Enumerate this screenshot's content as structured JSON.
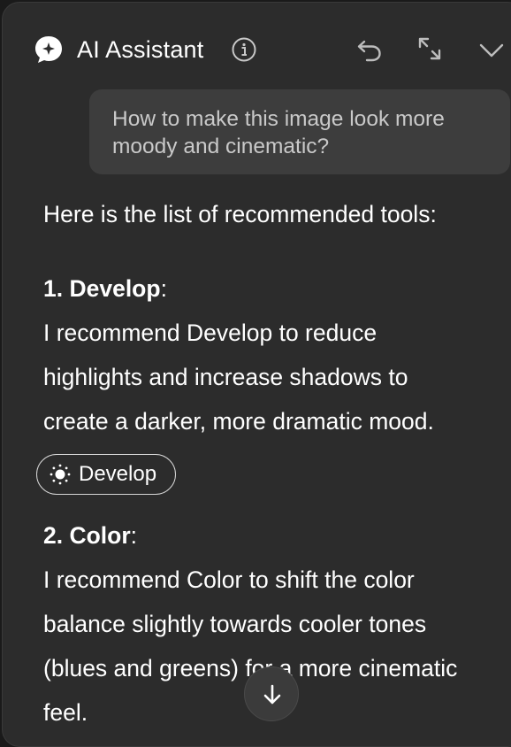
{
  "header": {
    "title": "AI Assistant",
    "icons": [
      "assistant-logo-icon",
      "info-icon",
      "undo-icon",
      "expand-icon",
      "chevron-down-icon"
    ]
  },
  "user_message": {
    "text": "How to make this image look more moody and cinematic?"
  },
  "assistant": {
    "intro": "Here is the list of recommended tools:",
    "items": [
      {
        "heading": "1. Develop",
        "heading_suffix": ":",
        "lines": [
          "I recommend Develop to reduce",
          "highlights and increase shadows to",
          "create a darker, more dramatic mood."
        ],
        "chip_label": "Develop"
      },
      {
        "heading": "2. Color",
        "heading_suffix": ":",
        "lines": [
          "I recommend Color to shift the color",
          "balance slightly towards cooler tones",
          "(blues and greens) for a more cinematic",
          "feel."
        ]
      }
    ]
  },
  "colors": {
    "panel_bg": "#2c2c2c",
    "bubble_bg": "#3d3d3d",
    "text": "#ffffff",
    "muted_text": "#c9c9c9"
  }
}
